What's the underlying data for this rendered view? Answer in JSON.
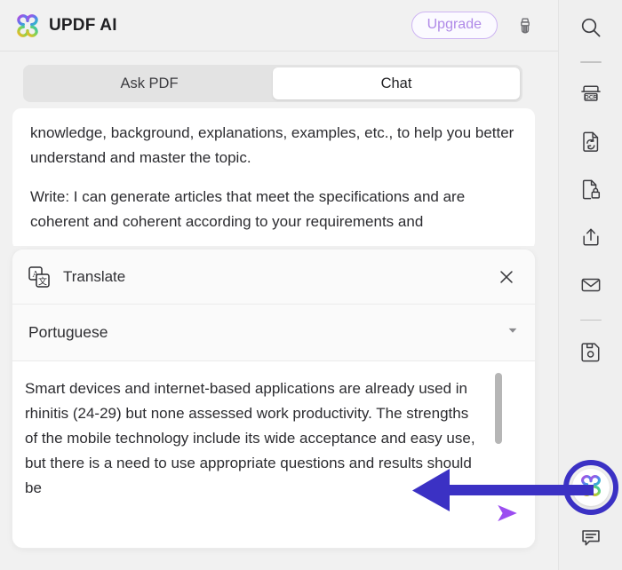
{
  "header": {
    "brand_title": "UPDF AI",
    "logo_icon": "updf-flower-logo",
    "upgrade_label": "Upgrade",
    "clean_icon": "brush-icon"
  },
  "tabs": [
    {
      "label": "Ask PDF",
      "active": false
    },
    {
      "label": "Chat",
      "active": true
    }
  ],
  "chat": {
    "messages": [
      "knowledge, background, explanations, examples, etc., to help you better understand and master the topic.",
      "Write: I can generate articles that meet the specifications and are coherent and coherent according to your requirements and"
    ]
  },
  "translate": {
    "icon": "translate-icon",
    "title": "Translate",
    "close_icon": "close-icon",
    "language_selected": "Portuguese",
    "language_caret_icon": "chevron-down-icon",
    "source_text": "Smart devices and internet-based applications are already used in rhinitis (24-29) but none assessed work productivity. The strengths of the mobile technology include its wide acceptance and easy use, but there is a need to use appropriate questions and results should be",
    "send_icon": "send-icon",
    "scrollbar": "vertical-scrollbar"
  },
  "rail": {
    "items": [
      {
        "name": "search",
        "icon": "search-icon"
      },
      {
        "name": "separator-1",
        "icon": "divider"
      },
      {
        "name": "ocr",
        "icon": "ocr-icon"
      },
      {
        "name": "convert",
        "icon": "convert-document-icon"
      },
      {
        "name": "protect",
        "icon": "document-lock-icon"
      },
      {
        "name": "share",
        "icon": "share-upload-icon"
      },
      {
        "name": "email",
        "icon": "envelope-icon"
      },
      {
        "name": "separator-2",
        "icon": "divider"
      },
      {
        "name": "save",
        "icon": "floppy-save-icon"
      }
    ],
    "ai_button": {
      "icon": "updf-flower-logo",
      "highlight_color": "#3b31c4"
    },
    "comment_button": {
      "icon": "comment-icon"
    }
  },
  "annotation": {
    "arrow_icon": "left-pointing-arrow",
    "arrow_color": "#3b31c4"
  },
  "colors": {
    "accent_purple": "#a855f7",
    "upgrade_purple": "#b08ae8",
    "indigo": "#3b31c4",
    "panel_bg": "#f1f1f1",
    "card_bg": "#fafafa"
  }
}
